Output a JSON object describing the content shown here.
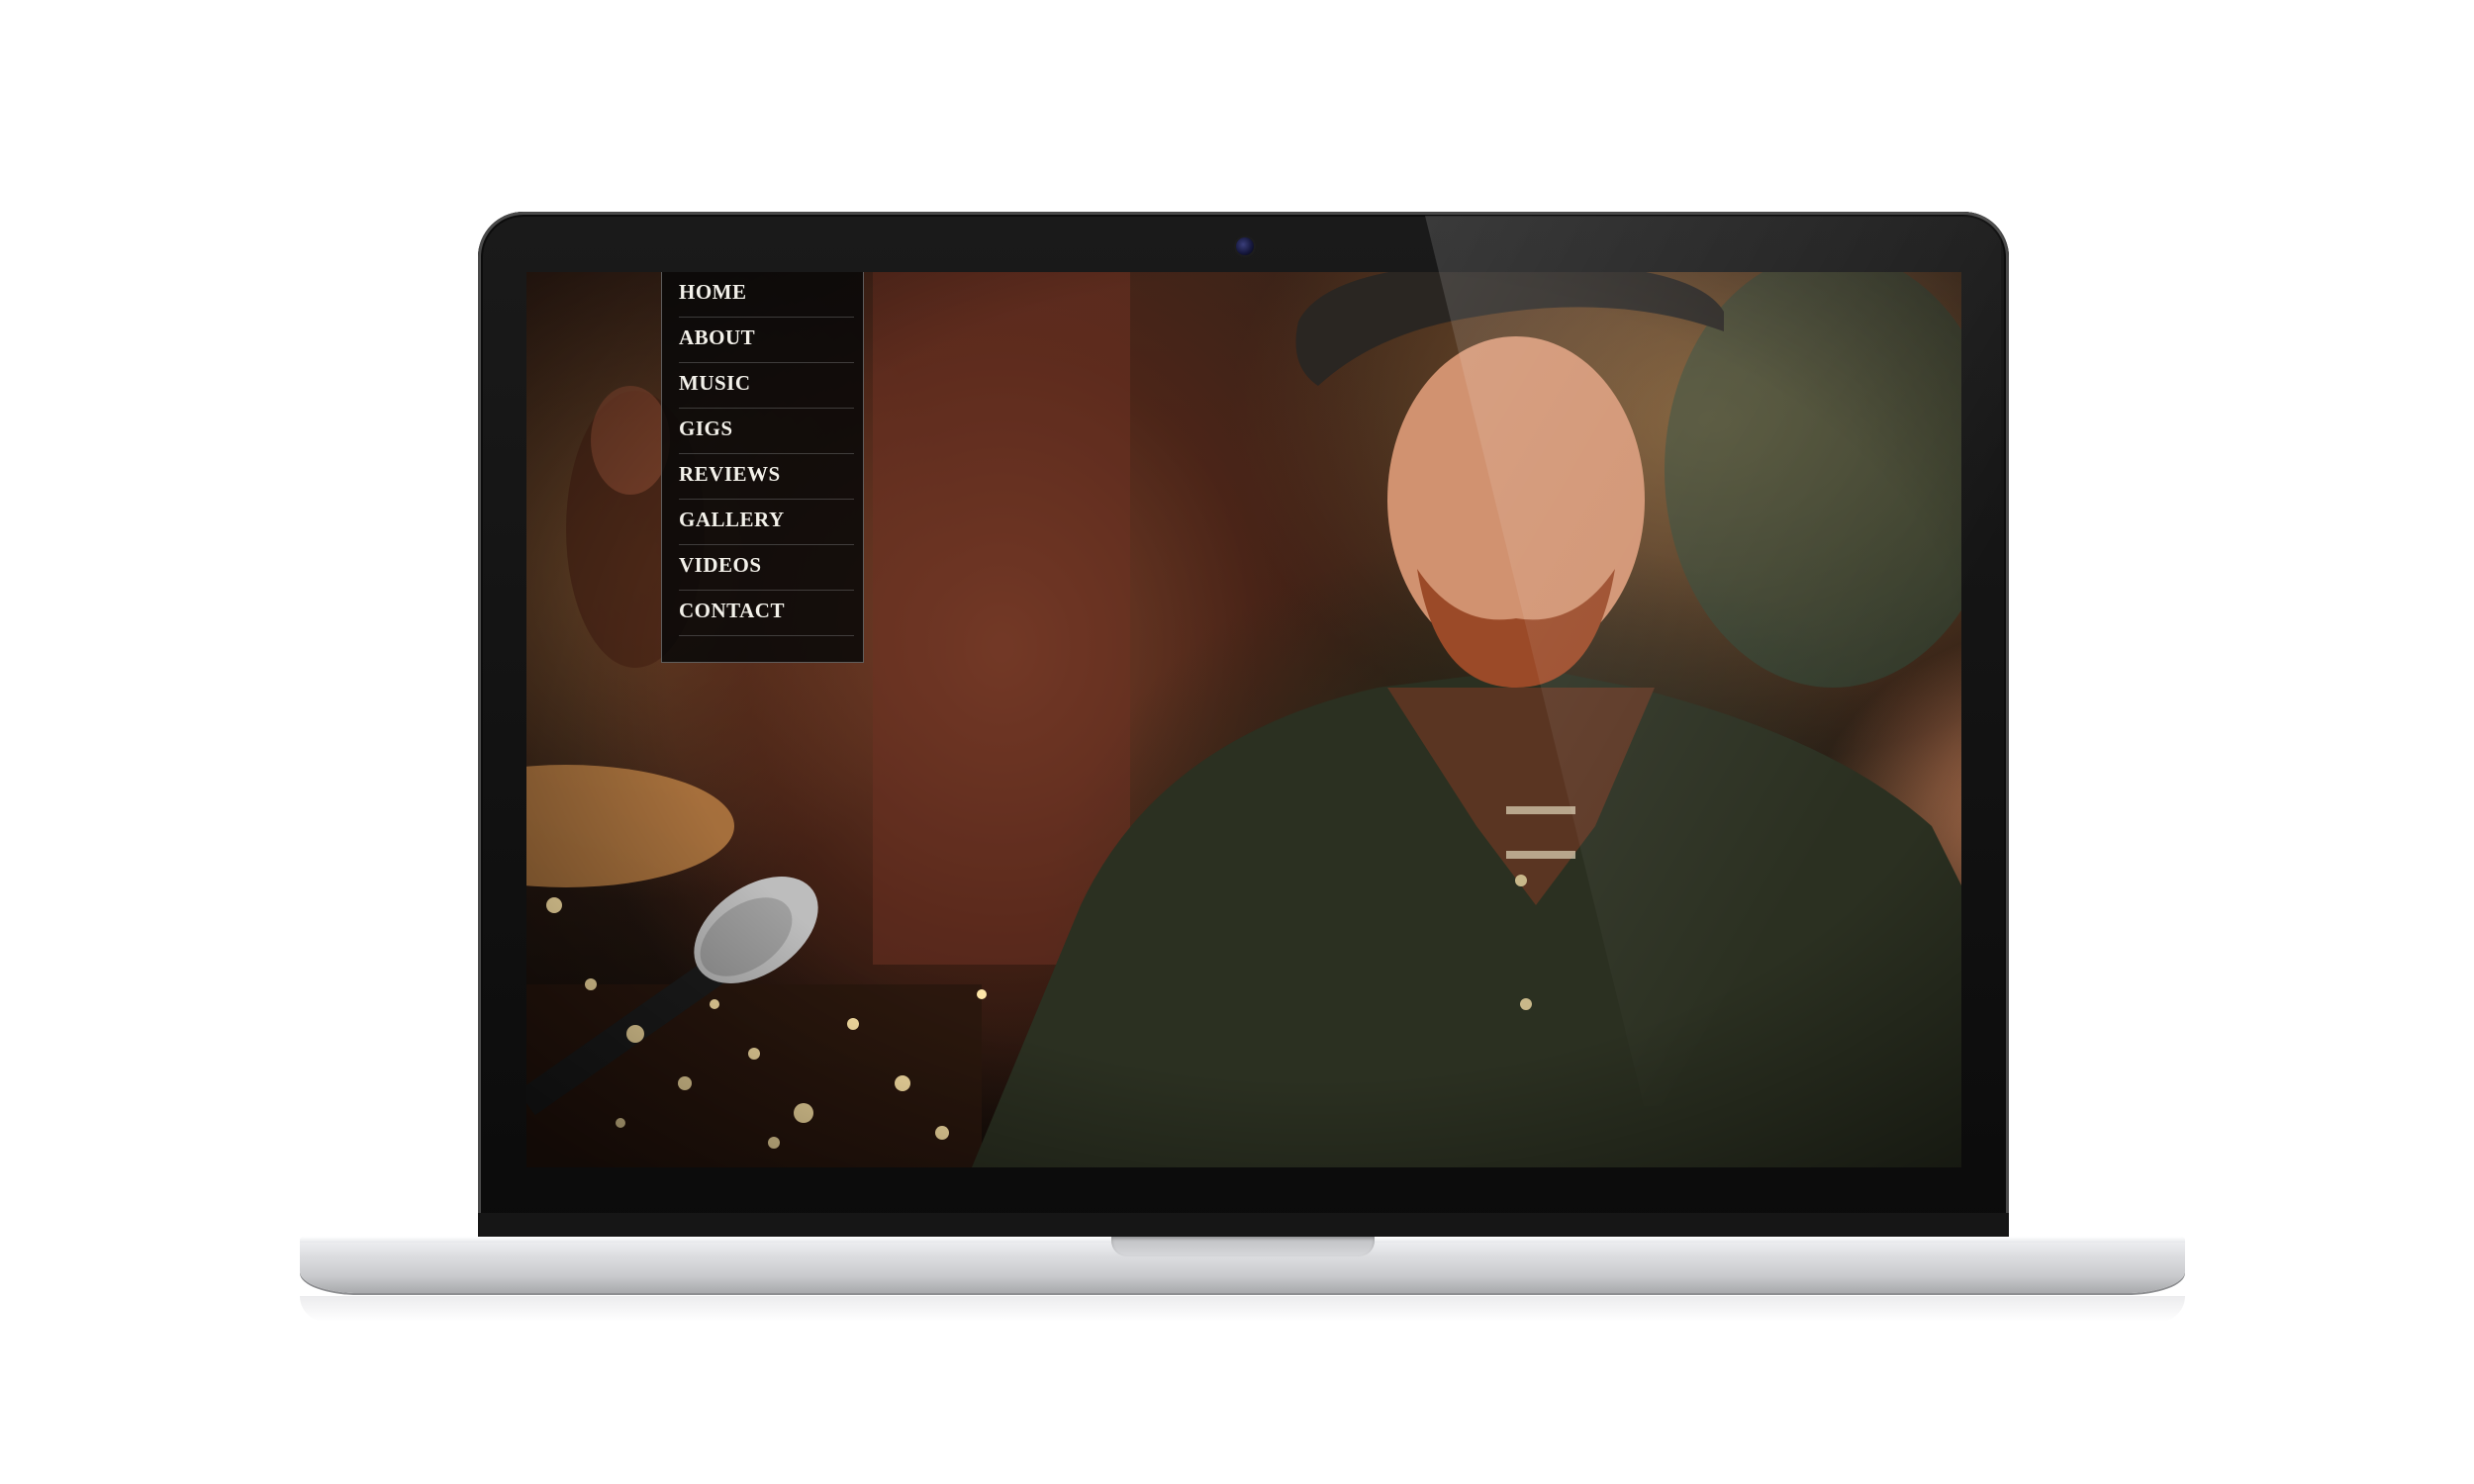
{
  "nav": {
    "items": [
      {
        "label": "HOME"
      },
      {
        "label": "ABOUT"
      },
      {
        "label": "MUSIC"
      },
      {
        "label": "GIGS"
      },
      {
        "label": "REVIEWS"
      },
      {
        "label": "GALLERY"
      },
      {
        "label": "VIDEOS"
      },
      {
        "label": "CONTACT"
      }
    ]
  },
  "colors": {
    "nav_background": "#080808",
    "nav_text": "#f3f1ea",
    "page_background": "#ffffff"
  },
  "icons": {
    "camera": "camera-dot-icon"
  }
}
